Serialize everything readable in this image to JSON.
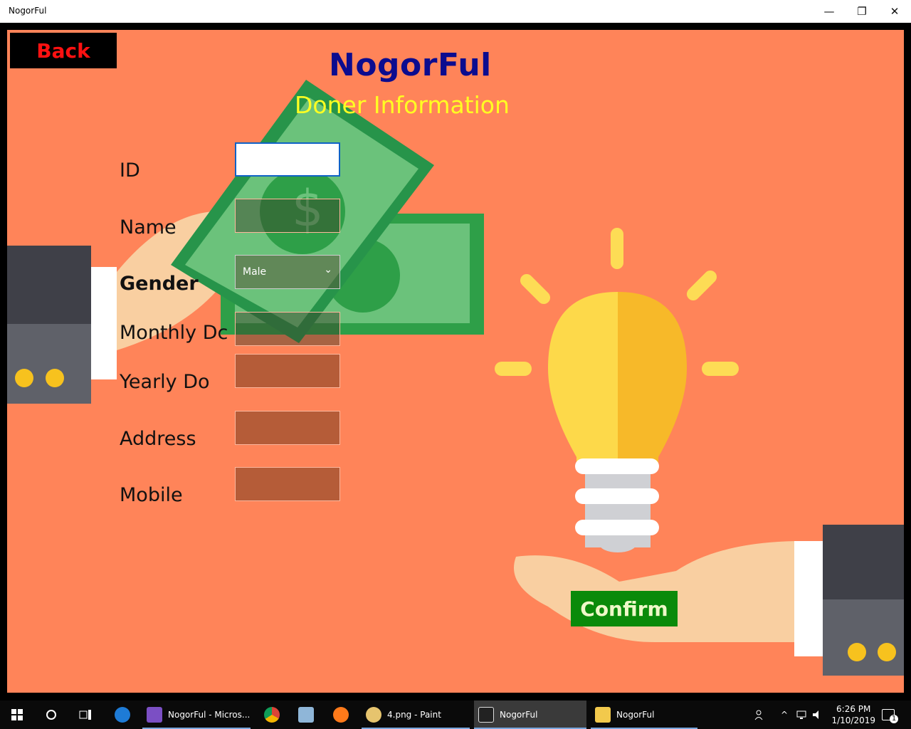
{
  "window": {
    "title": "NogorFul",
    "minimize": "—",
    "restore": "❐",
    "close": "✕"
  },
  "app": {
    "back_label": "Back",
    "title": "NogorFul",
    "subtitle": "Doner Information",
    "fields": {
      "id_label": "ID",
      "name_label": "Name",
      "gender_label": "Gender",
      "gender_value": "Male",
      "monthly_label": "Monthly Dc",
      "yearly_label": "Yearly Do",
      "address_label": "Address",
      "mobile_label": "Mobile"
    },
    "confirm_label": "Confirm"
  },
  "taskbar": {
    "items": [
      {
        "label": "NogorFul - Micros...",
        "icon": "visual-studio-icon"
      },
      {
        "label": "4.png - Paint",
        "icon": "paint-icon"
      },
      {
        "label": "NogorFul",
        "icon": "app-icon"
      },
      {
        "label": "NogorFul",
        "icon": "folder-icon"
      }
    ],
    "time": "6:26 PM",
    "date": "1/10/2019",
    "notifications": "1"
  },
  "colors": {
    "background": "#ff8459",
    "back_text": "#ff1111",
    "title": "#0c0c8f",
    "subtitle": "#ffff22",
    "confirm_bg": "#0a8a0a"
  }
}
